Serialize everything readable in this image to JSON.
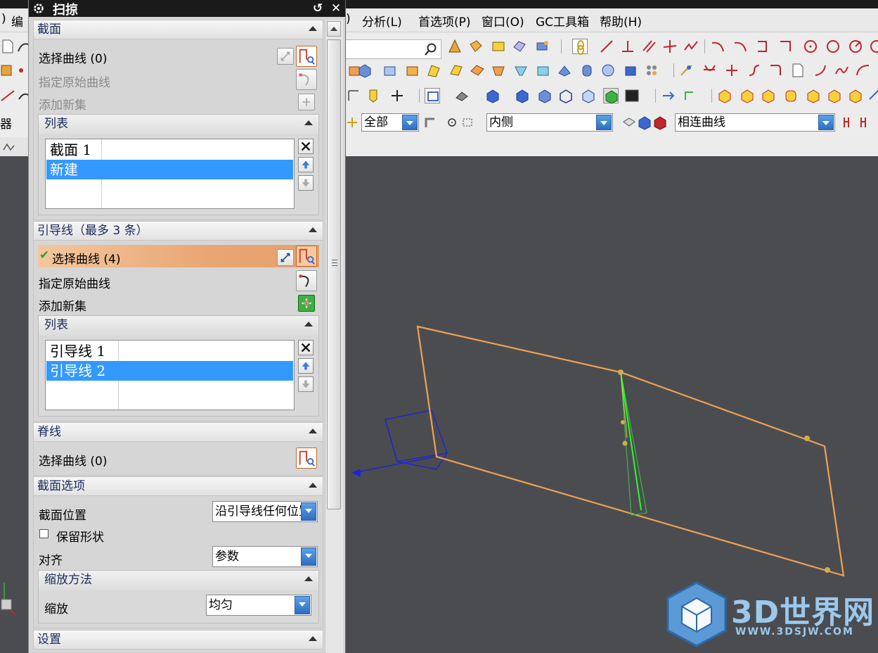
{
  "menubar": {
    "left_fragment": "编",
    "bracket_fragment": ")",
    "items": [
      "分析(L)",
      "首选项(P)",
      "窗口(O)",
      "GC工具箱",
      "帮助(H)"
    ]
  },
  "toolbar": {
    "left_label": "器",
    "filter_scope": "全部",
    "face_rule": "内侧",
    "curve_rule": "相连曲线"
  },
  "dialog": {
    "title": "扫掠",
    "title_buttons": [
      "↺",
      "✕"
    ],
    "section": {
      "header": "截面",
      "select_curve": "选择曲线 (0)",
      "specify_origin_curve": "指定原始曲线",
      "add_new_set": "添加新集",
      "list_header": "列表",
      "list_items": [
        "截面 1",
        "新建"
      ],
      "selected_index": 1
    },
    "guides": {
      "header": "引导线（最多 3 条）",
      "select_curve": "选择曲线 (4)",
      "specify_origin_curve": "指定原始曲线",
      "add_new_set": "添加新集",
      "list_header": "列表",
      "list_items": [
        "引导线 1",
        "引导线 2"
      ],
      "selected_index": 1
    },
    "spine": {
      "header": "脊线",
      "select_curve": "选择曲线 (0)"
    },
    "section_options": {
      "header": "截面选项",
      "position_label": "截面位置",
      "position_value": "沿引导线任何位置",
      "preserve_shape_label": "保留形状",
      "preserve_shape_checked": false,
      "alignment_label": "对齐",
      "alignment_value": "参数",
      "scaling_header": "缩放方法",
      "scale_label": "缩放",
      "scale_value": "均匀"
    },
    "settings": {
      "header": "设置"
    }
  },
  "watermark": {
    "text": "3D世界网",
    "url": "WWW.3DSJW.COM"
  },
  "colors": {
    "accent_blue": "#3399ff",
    "active_row_orange": "#e9a673",
    "curve_orange": "#f0a050",
    "viewport_bg": "#4a4c50"
  }
}
